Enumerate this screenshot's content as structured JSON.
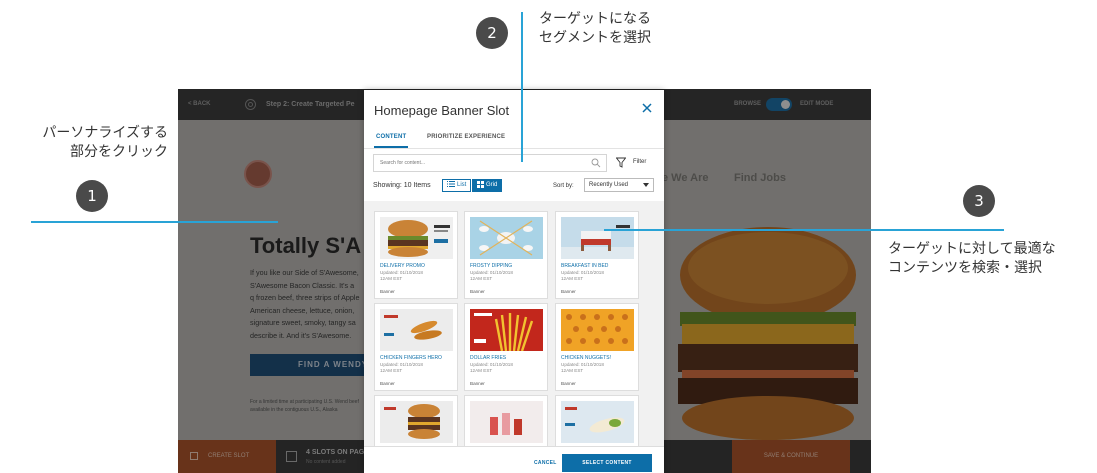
{
  "callouts": [
    {
      "number": "1",
      "line1": "パーソナライズする",
      "line2": "部分をクリック"
    },
    {
      "number": "2",
      "line1": "ターゲットになる",
      "line2": "セグメントを選択"
    },
    {
      "number": "3",
      "line1": "ターゲットに対して最適な",
      "line2": "コンテンツを検索・選択"
    }
  ],
  "app": {
    "topbar": {
      "back_label": "< BACK",
      "step_label": "Step 2: Create Targeted Pe",
      "browse_label": "BROWSE",
      "edit_mode_label": "EDIT MODE"
    },
    "site": {
      "nav_items": [
        "e We Are",
        "Find Jobs"
      ],
      "heading": "Totally S'A",
      "body": "If you like our Side of S'Awesome, S'Awesome Bacon Classic. It's a q frozen beef, three strips of Apple American cheese, lettuce, onion, signature sweet, smoky, tangy sa describe it. And it's S'Awesome.",
      "cta_label": "FIND A WENDY'S",
      "fine_print": "For a limited time at participating U.S. Wend beef available in the contiguous U.S., Alaska"
    },
    "bottom_bar": {
      "create_slot_label": "CREATE SLOT",
      "slots_label": "4 SLOTS ON PAGE",
      "slots_sub": "No content added",
      "save_label": "SAVE & CONTINUE"
    }
  },
  "modal": {
    "title": "Homepage Banner Slot",
    "tabs": [
      {
        "label": "CONTENT",
        "active": true
      },
      {
        "label": "PRIORITIZE EXPERIENCE",
        "active": false
      }
    ],
    "search_placeholder": "Search for content...",
    "filter_label": "Filter",
    "showing_label": "Showing: 10 Items",
    "view_list_label": "List",
    "view_grid_label": "Grid",
    "sort_by_label": "Sort by:",
    "sort_value": "Recently Used",
    "cards": [
      {
        "title": "DELIVERY PROMO",
        "updated": "Updated: 01/10/2018",
        "time": "12AM EST",
        "type": "Banner",
        "thumb": "burger"
      },
      {
        "title": "FROSTY DIPPING",
        "updated": "Updated: 01/10/2018",
        "time": "12AM EST",
        "type": "Banner",
        "thumb": "frosty"
      },
      {
        "title": "BREAKFAST IN BED",
        "updated": "Updated: 01/10/2018",
        "time": "12AM EST",
        "type": "Banner",
        "thumb": "bed"
      },
      {
        "title": "CHICKEN FINGERS HERO",
        "updated": "Updated: 01/10/2018",
        "time": "12AM EST",
        "type": "Banner",
        "thumb": "chicken"
      },
      {
        "title": "DOLLAR FRIES",
        "updated": "Updated: 01/10/2018",
        "time": "12AM EST",
        "type": "Banner",
        "thumb": "fries"
      },
      {
        "title": "CHICKEN NUGGETS!",
        "updated": "Updated: 01/10/2018",
        "time": "12AM EST",
        "type": "Banner",
        "thumb": "nuggets"
      },
      {
        "title": "",
        "updated": "",
        "time": "",
        "type": "",
        "thumb": "burger2"
      },
      {
        "title": "",
        "updated": "",
        "time": "",
        "type": "",
        "thumb": "drinks"
      },
      {
        "title": "",
        "updated": "",
        "time": "",
        "type": "",
        "thumb": "wrap"
      }
    ],
    "cancel_label": "CANCEL",
    "select_label": "SELECT CONTENT"
  },
  "colors": {
    "accent": "#0d6ea8",
    "callout_line": "#29a3d6",
    "badge": "#4a4a4a",
    "brand_orange": "#a9532a"
  }
}
